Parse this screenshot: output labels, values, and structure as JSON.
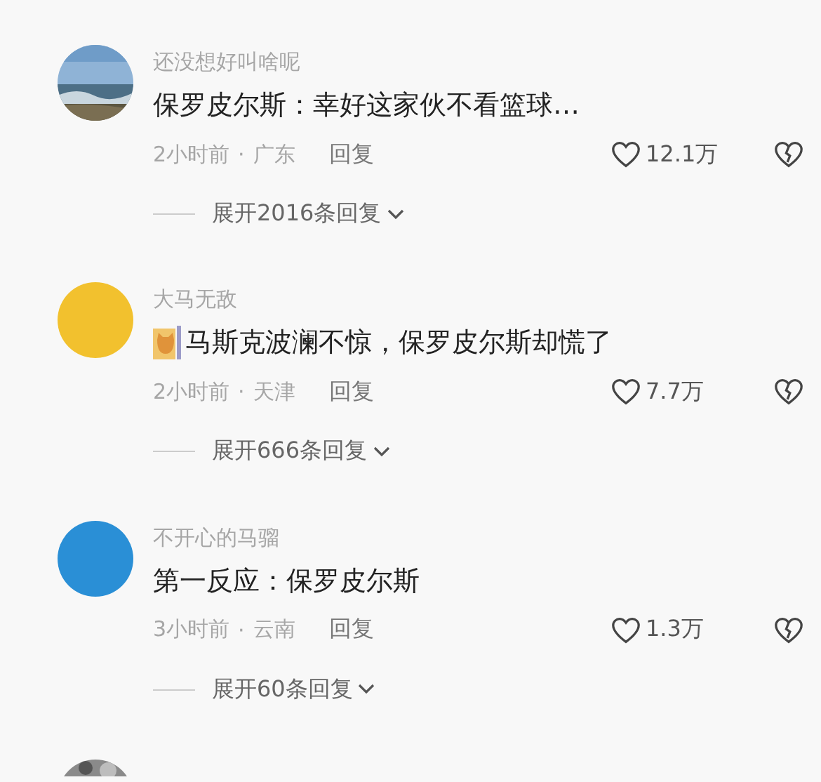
{
  "comments": [
    {
      "username": "还没想好叫啥呢",
      "sticker": false,
      "text": "保罗皮尔斯：幸好这家伙不看篮球…",
      "time": "2小时前",
      "separator": "·",
      "location": "广东",
      "reply": "回复",
      "likes": "12.1万",
      "expand": "展开2016条回复"
    },
    {
      "avatar": {
        "kind": "plain",
        "color": "#f2c12e"
      },
      "username": "大马无敌",
      "sticker": true,
      "text": "马斯克波澜不惊，保罗皮尔斯却慌了",
      "time": "2小时前",
      "separator": "·",
      "location": "天津",
      "reply": "回复",
      "likes": "7.7万",
      "expand": "展开666条回复"
    },
    {
      "avatar": {
        "kind": "plain",
        "color": "#2a8fd6"
      },
      "username": "不开心的马骝",
      "sticker": false,
      "text": "第一反应：保罗皮尔斯",
      "time": "3小时前",
      "separator": "·",
      "location": "云南",
      "reply": "回复",
      "likes": "1.3万",
      "expand": "展开60条回复"
    }
  ]
}
